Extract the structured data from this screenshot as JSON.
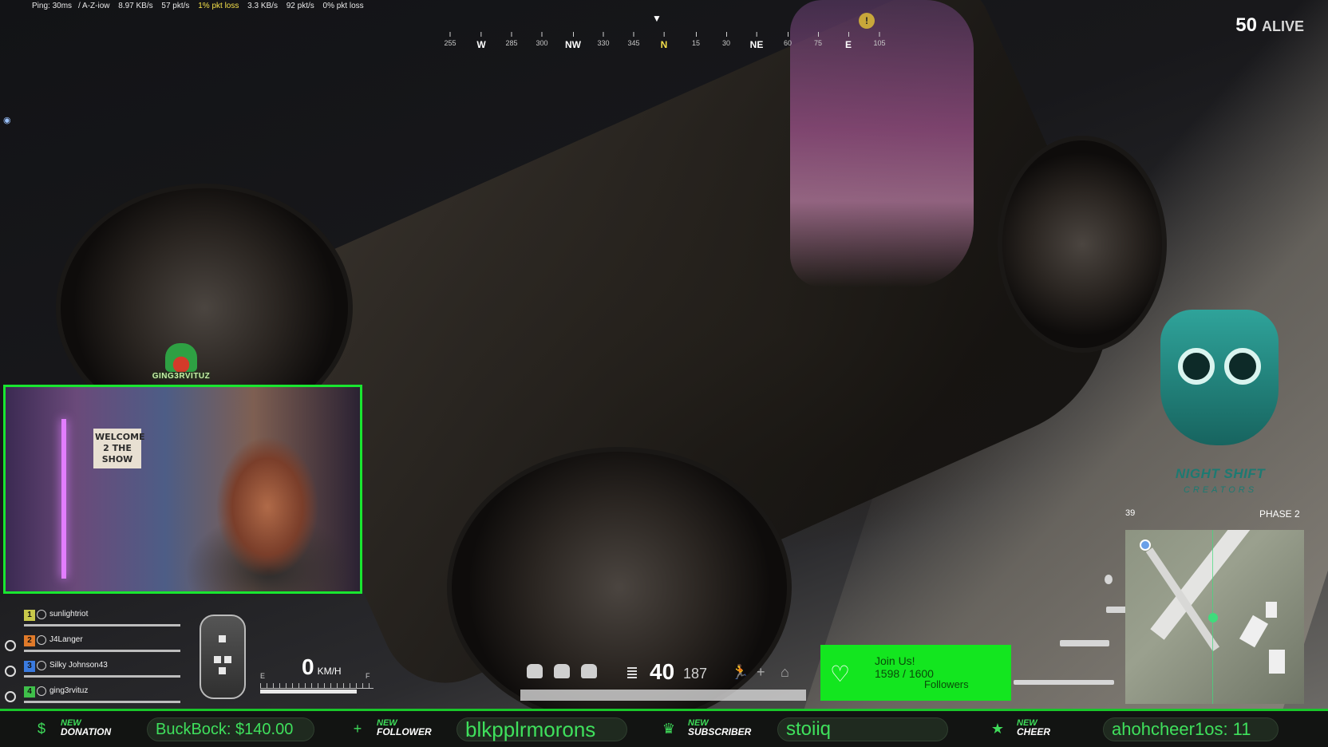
{
  "netstats": {
    "ping": "Ping: 30ms",
    "region": "/ A-Z-iow",
    "down_kb": "8.97 KB/s",
    "down_pkt": "57 pkt/s",
    "down_loss": "1% pkt loss",
    "up_kb": "3.3 KB/s",
    "up_pkt": "92 pkt/s",
    "up_loss": "0% pkt loss"
  },
  "compass": {
    "marks": [
      "255",
      "W",
      "285",
      "300",
      "NW",
      "330",
      "345",
      "N",
      "15",
      "30",
      "NE",
      "60",
      "75",
      "E",
      "105"
    ],
    "marker_glyph": "!"
  },
  "alive": {
    "count": "50",
    "label": "ALIVE"
  },
  "webcam": {
    "logo_text": "GING3RVITUZ",
    "sign_text": "WELCOME 2 THE SHOW"
  },
  "squad": [
    {
      "index": "1",
      "name": "sunlightriot",
      "color": "#c8c84a"
    },
    {
      "index": "2",
      "name": "J4Langer",
      "color": "#e07a2a"
    },
    {
      "index": "3",
      "name": "Silky Johnson43",
      "color": "#3a7be0"
    },
    {
      "index": "4",
      "name": "ging3rvituz",
      "color": "#3fbf4a"
    }
  ],
  "vehicle": {
    "speed": "0",
    "unit": "KM/H",
    "fuel_level": 0.85,
    "fuel_empty": "E",
    "fuel_full": "F"
  },
  "inventory": {
    "ammo_loaded": "40",
    "ammo_total": "187",
    "icons": [
      "backpack-icon",
      "helmet-icon",
      "vest-icon"
    ]
  },
  "follower_goal": {
    "title": "Join Us!",
    "progress": "1598 / 1600",
    "label": "Followers"
  },
  "branding": {
    "name": "NIGHT SHIFT",
    "sub": "CREATORS"
  },
  "minimap": {
    "count": "39",
    "phase": "PHASE 2"
  },
  "alerts": [
    {
      "new": "NEW",
      "kind": "DONATION",
      "value": "BuckBock: $140.00",
      "icon": "$"
    },
    {
      "new": "NEW",
      "kind": "FOLLOWER",
      "value": "blkpplrmorons",
      "icon": "+"
    },
    {
      "new": "NEW",
      "kind": "SUBSCRIBER",
      "value": "stoiiq",
      "icon": "♛"
    },
    {
      "new": "NEW",
      "kind": "CHEER",
      "value": "ahohcheer1os: 11",
      "icon": "★"
    }
  ],
  "colors": {
    "accent_green": "#19e630",
    "alert_green": "#3fdc5a",
    "owl_teal": "#2fa39a"
  }
}
